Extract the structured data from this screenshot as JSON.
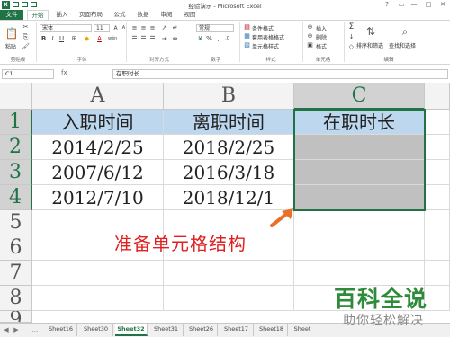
{
  "window": {
    "title": "经验演示 - Microsoft Excel",
    "logo": "X",
    "controls": [
      "?",
      "▭",
      "—",
      "□",
      "✕"
    ]
  },
  "ribbon_tabs": [
    "文件",
    "开始",
    "插入",
    "页面布局",
    "公式",
    "数据",
    "审阅",
    "视图"
  ],
  "ribbon": {
    "clipboard": {
      "paste": "粘贴",
      "label": "剪贴板"
    },
    "font": {
      "name": "宋体",
      "size": "11",
      "bold": "B",
      "italic": "I",
      "underline": "U",
      "grow": "A",
      "shrink": "A",
      "wen": "wén",
      "label": "字体"
    },
    "alignment": {
      "label": "对齐方式"
    },
    "number": {
      "format": "常规",
      "percent": "%",
      "comma": ",",
      "label": "数字"
    },
    "styles": {
      "conditional": "条件格式",
      "table": "套用表格格式",
      "cell_styles": "单元格样式",
      "label": "样式"
    },
    "cells": {
      "insert": "插入",
      "delete": "删除",
      "format": "格式",
      "label": "单元格"
    },
    "editing": {
      "sort": "排序和筛选",
      "find": "查找和选择",
      "label": "编辑"
    }
  },
  "formula_bar": {
    "name_box": "C1",
    "fx": "fx",
    "formula": "在职时长"
  },
  "columns": [
    "A",
    "B",
    "C"
  ],
  "rows": [
    "1",
    "2",
    "3",
    "4",
    "5",
    "6",
    "7",
    "8",
    "9"
  ],
  "table": {
    "headers": [
      "入职时间",
      "离职时间",
      "在职时长"
    ],
    "rows": [
      [
        "2014/2/25",
        "2018/2/25",
        ""
      ],
      [
        "2007/6/12",
        "2016/3/18",
        ""
      ],
      [
        "2012/7/10",
        "2018/12/1",
        ""
      ]
    ]
  },
  "annotation": "准备单元格结构",
  "colors": {
    "accent": "#217346",
    "header_fill": "#bdd7ee",
    "highlight_fill": "#c0c0c0",
    "annotation": "#e02020"
  },
  "sheet_tabs": [
    "Sheet16",
    "Sheet30",
    "Sheet32",
    "Sheet31",
    "Sheet26",
    "Sheet17",
    "Sheet18",
    "Sheet"
  ],
  "active_sheet": "Sheet32",
  "sheet_nav": [
    "◀",
    "▶",
    "..."
  ],
  "watermark": {
    "brand": "百科全说",
    "tagline": "助你轻松解决"
  }
}
